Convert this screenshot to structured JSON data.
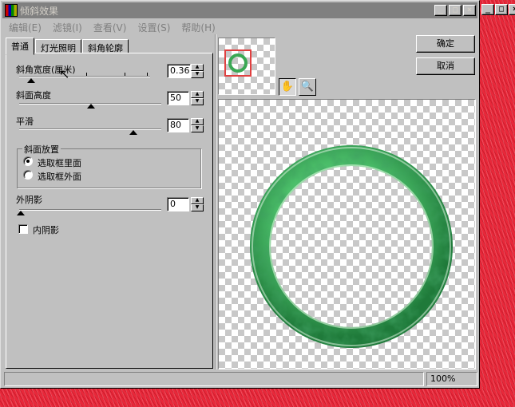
{
  "window": {
    "title": "倾斜效果",
    "min_glyph": "_",
    "max_glyph": "□",
    "close_glyph": "×"
  },
  "outer_window": {
    "min_glyph": "_",
    "max_glyph": "□",
    "close_glyph": "×"
  },
  "menu": [
    {
      "label": "编辑(E)"
    },
    {
      "label": "滤镜(I)"
    },
    {
      "label": "查看(V)"
    },
    {
      "label": "设置(S)"
    },
    {
      "label": "帮助(H)"
    }
  ],
  "tabs": [
    {
      "label": "普通",
      "active": true
    },
    {
      "label": "灯光照明",
      "active": false
    },
    {
      "label": "斜角轮廓",
      "active": false
    }
  ],
  "controls": {
    "bevel_width": {
      "label": "斜角宽度(厘米)",
      "value": "0.36"
    },
    "bevel_height": {
      "label": "斜面高度",
      "value": "50"
    },
    "smoothness": {
      "label": "平滑",
      "value": "80"
    },
    "bevel_position": {
      "legend": "斜面放置",
      "options": [
        {
          "label": "选取框里面",
          "selected": true
        },
        {
          "label": "选取框外面",
          "selected": false
        }
      ]
    },
    "outer_shadow": {
      "label": "外阴影",
      "value": "0"
    },
    "inner_shadow": {
      "label": "内阴影",
      "checked": false
    }
  },
  "buttons": {
    "ok": "确定",
    "cancel": "取消"
  },
  "tools": {
    "hand": "✋",
    "zoom": "🔍"
  },
  "status": {
    "message": "",
    "zoom": "100%"
  },
  "colors": {
    "ring_green": "#3aa854",
    "selection_red": "#e04040",
    "backdrop_red": "#e8283a"
  }
}
